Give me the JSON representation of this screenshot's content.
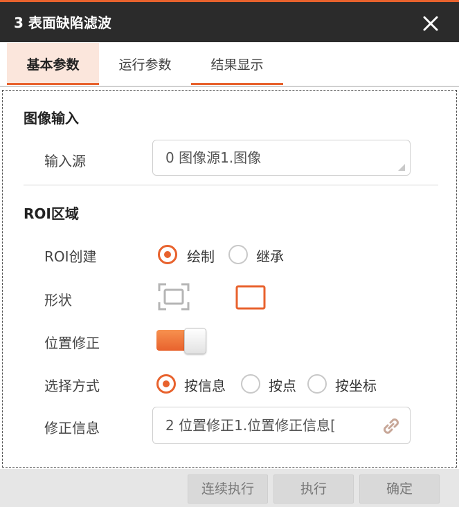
{
  "window": {
    "title": "3 表面缺陷滤波",
    "close_icon": "close-icon",
    "accent_color": "#e8622d"
  },
  "tabs": [
    {
      "label": "基本参数",
      "active": true
    },
    {
      "label": "运行参数",
      "active": false
    },
    {
      "label": "结果显示",
      "active": false
    }
  ],
  "image_input": {
    "section_title": "图像输入",
    "source_label": "输入源",
    "source_value": "0 图像源1.图像"
  },
  "roi": {
    "section_title": "ROI区域",
    "create_label": "ROI创建",
    "create_options": [
      {
        "label": "绘制",
        "selected": true
      },
      {
        "label": "继承",
        "selected": false
      }
    ],
    "shape_label": "形状",
    "shape_options": [
      {
        "icon": "roi-corners-icon",
        "selected": false
      },
      {
        "icon": "rectangle-icon",
        "selected": true
      }
    ],
    "position_fix_label": "位置修正",
    "position_fix_on": true,
    "select_mode_label": "选择方式",
    "select_mode_options": [
      {
        "label": "按信息",
        "selected": true
      },
      {
        "label": "按点",
        "selected": false
      },
      {
        "label": "按坐标",
        "selected": false
      }
    ],
    "fix_info_label": "修正信息",
    "fix_info_value": "2 位置修正1.位置修正信息[",
    "link_icon": "link-icon"
  },
  "footer": {
    "continuous_label": "连续执行",
    "execute_label": "执行",
    "confirm_label": "确定"
  }
}
